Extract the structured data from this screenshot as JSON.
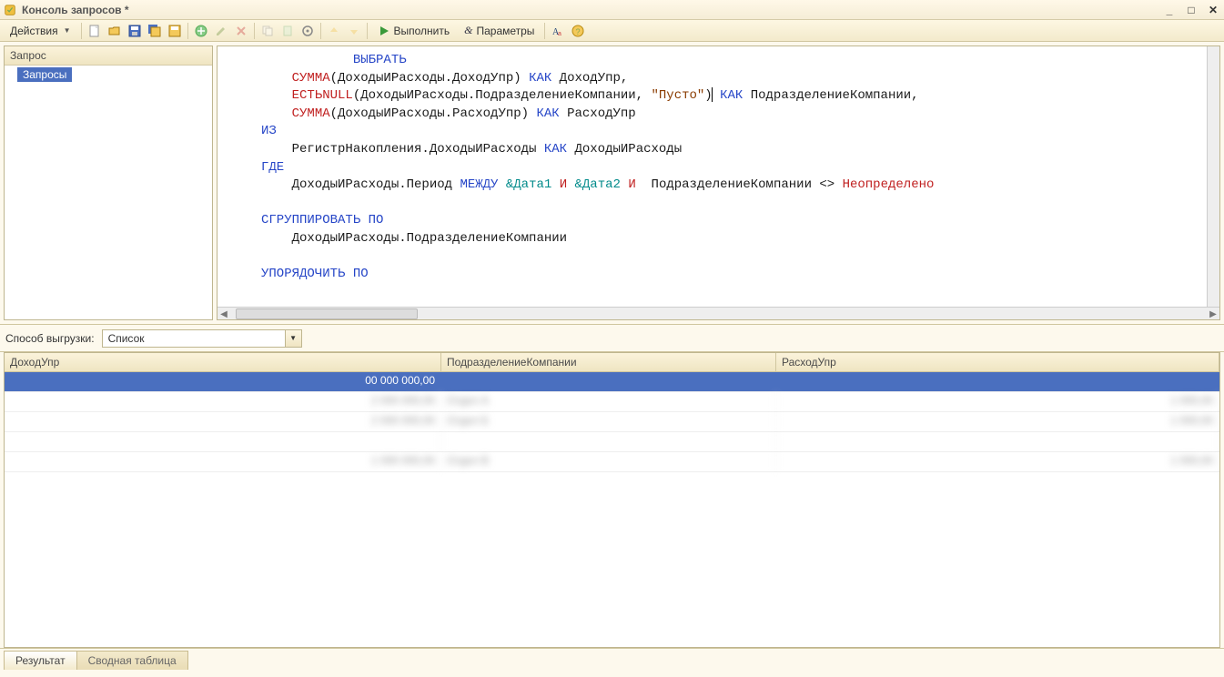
{
  "window": {
    "title": "Консоль запросов *"
  },
  "toolbar": {
    "actions_label": "Действия",
    "execute_label": "Выполнить",
    "parameters_label": "Параметры"
  },
  "tree": {
    "header": "Запрос",
    "root": "Запросы"
  },
  "editor": {
    "tokens": [
      [
        "    ",
        [
          "kw-blue",
          "ВЫБРАТЬ"
        ]
      ],
      [
        [
          "kw-red",
          "СУММА"
        ],
        "(ДоходыИРасходы.ДоходУпр) ",
        [
          "kw-blue",
          "КАК"
        ],
        " ДоходУпр,"
      ],
      [
        [
          "kw-red",
          "ЕСТЬNULL"
        ],
        "(ДоходыИРасходы.ПодразделениеКомпании, ",
        [
          "kw-brown",
          "\"Пусто\""
        ],
        ")",
        [
          "cursor",
          ""
        ],
        " ",
        [
          "kw-blue",
          "КАК"
        ],
        " ПодразделениеКомпании,"
      ],
      [
        [
          "kw-red",
          "СУММА"
        ],
        "(ДоходыИРасходы.РасходУпр) ",
        [
          "kw-blue",
          "КАК"
        ],
        " РасходУпр"
      ],
      [
        [
          "kw-blue",
          "ИЗ"
        ]
      ],
      [
        "РегистрНакопления.ДоходыИРасходы ",
        [
          "kw-blue",
          "КАК"
        ],
        " ДоходыИРасходы"
      ],
      [
        [
          "kw-blue",
          "ГДЕ"
        ]
      ],
      [
        "ДоходыИРасходы.Период ",
        [
          "kw-blue",
          "МЕЖДУ"
        ],
        " ",
        [
          "kw-teal",
          "&Дата1"
        ],
        " ",
        [
          "kw-red",
          "И"
        ],
        " ",
        [
          "kw-teal",
          "&Дата2"
        ],
        " ",
        [
          "kw-red",
          "И"
        ],
        "  ПодразделениеКомпании <> ",
        [
          "kw-red",
          "Неопределено"
        ]
      ],
      [
        ""
      ],
      [
        [
          "kw-blue",
          "СГРУППИРОВАТЬ ПО"
        ]
      ],
      [
        "ДоходыИРасходы.ПодразделениеКомпании"
      ],
      [
        ""
      ],
      [
        [
          "kw-blue",
          "УПОРЯДОЧИТЬ ПО"
        ]
      ]
    ]
  },
  "export": {
    "label": "Способ выгрузки:",
    "selected": "Список"
  },
  "grid": {
    "columns": [
      "ДоходУпр",
      "ПодразделениеКомпании",
      "РасходУпр"
    ],
    "rows": [
      {
        "c1": "00 000 000,00",
        "c2": "",
        "c3": "",
        "selected": true
      },
      {
        "c1": "2 000 000,00",
        "c2": "Отдел А",
        "c3": "1 000,00"
      },
      {
        "c1": "2 000 000,00",
        "c2": "Отдел Б",
        "c3": "1 000,00"
      },
      {
        "c1": "",
        "c2": "",
        "c3": ""
      },
      {
        "c1": "1 000 000,00",
        "c2": "Отдел В",
        "c3": "1 000,00"
      }
    ]
  },
  "tabs": {
    "result": "Результат",
    "pivot": "Сводная таблица"
  }
}
